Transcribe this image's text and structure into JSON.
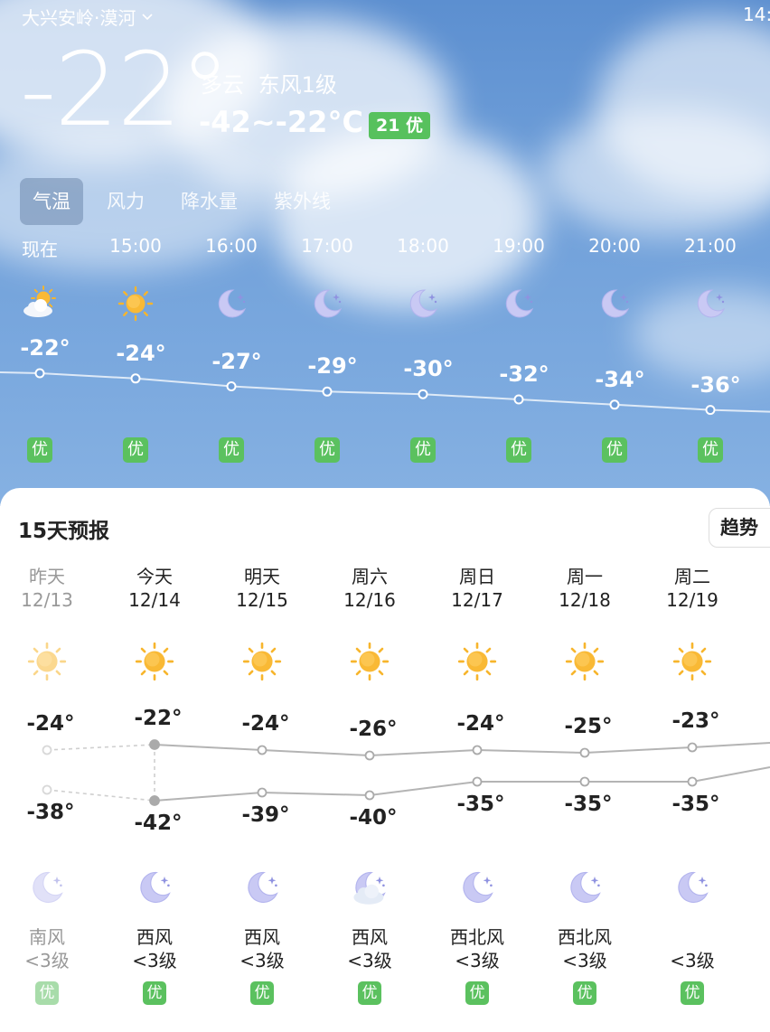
{
  "header": {
    "location": "大兴安岭·漠河",
    "clock": "14:",
    "current_temp": "-22°",
    "condition": "多云  东风1级",
    "temp_range": "-42~-22°C",
    "aqi_badge": "21 优"
  },
  "tabs": [
    "气温",
    "风力",
    "降水量",
    "紫外线"
  ],
  "active_tab": "气温",
  "hourly": [
    {
      "time": "现在",
      "icon": "partly-cloudy-icon",
      "temp": -22,
      "temp_label": "-22°",
      "aqi": "优"
    },
    {
      "time": "15:00",
      "icon": "sun-icon",
      "temp": -24,
      "temp_label": "-24°",
      "aqi": "优"
    },
    {
      "time": "16:00",
      "icon": "moon-icon",
      "temp": -27,
      "temp_label": "-27°",
      "aqi": "优"
    },
    {
      "time": "17:00",
      "icon": "moon-icon",
      "temp": -29,
      "temp_label": "-29°",
      "aqi": "优"
    },
    {
      "time": "18:00",
      "icon": "moon-icon",
      "temp": -30,
      "temp_label": "-30°",
      "aqi": "优"
    },
    {
      "time": "19:00",
      "icon": "moon-icon",
      "temp": -32,
      "temp_label": "-32°",
      "aqi": "优"
    },
    {
      "time": "20:00",
      "icon": "moon-icon",
      "temp": -34,
      "temp_label": "-34°",
      "aqi": "优"
    },
    {
      "time": "21:00",
      "icon": "moon-icon",
      "temp": -36,
      "temp_label": "-36°",
      "aqi": "优"
    }
  ],
  "forecast": {
    "title": "15天预报",
    "trend_button": "趋势",
    "days": [
      {
        "name": "昨天",
        "date": "12/13",
        "day_icon": "sun-icon",
        "high": -24,
        "high_label": "-24°",
        "low": -38,
        "low_label": "-38°",
        "night_icon": "moon-icon",
        "wind_dir": "南风",
        "wind_level": "<3级",
        "aqi": "优",
        "past": true
      },
      {
        "name": "今天",
        "date": "12/14",
        "day_icon": "sun-icon",
        "high": -22,
        "high_label": "-22°",
        "low": -42,
        "low_label": "-42°",
        "night_icon": "moon-icon",
        "wind_dir": "西风",
        "wind_level": "<3级",
        "aqi": "优",
        "past": false
      },
      {
        "name": "明天",
        "date": "12/15",
        "day_icon": "sun-icon",
        "high": -24,
        "high_label": "-24°",
        "low": -39,
        "low_label": "-39°",
        "night_icon": "moon-icon",
        "wind_dir": "西风",
        "wind_level": "<3级",
        "aqi": "优",
        "past": false
      },
      {
        "name": "周六",
        "date": "12/16",
        "day_icon": "sun-icon",
        "high": -26,
        "high_label": "-26°",
        "low": -40,
        "low_label": "-40°",
        "night_icon": "cloudy-moon-icon",
        "wind_dir": "西风",
        "wind_level": "<3级",
        "aqi": "优",
        "past": false
      },
      {
        "name": "周日",
        "date": "12/17",
        "day_icon": "sun-icon",
        "high": -24,
        "high_label": "-24°",
        "low": -35,
        "low_label": "-35°",
        "night_icon": "moon-icon",
        "wind_dir": "西北风",
        "wind_level": "<3级",
        "aqi": "优",
        "past": false
      },
      {
        "name": "周一",
        "date": "12/18",
        "day_icon": "sun-icon",
        "high": -25,
        "high_label": "-25°",
        "low": -35,
        "low_label": "-35°",
        "night_icon": "moon-icon",
        "wind_dir": "西北风",
        "wind_level": "<3级",
        "aqi": "优",
        "past": false
      },
      {
        "name": "周二",
        "date": "12/19",
        "day_icon": "sun-icon",
        "high": -23,
        "high_label": "-23°",
        "low": -35,
        "low_label": "-35°",
        "night_icon": "moon-icon",
        "wind_dir": "",
        "wind_level": "<3级",
        "aqi": "优",
        "past": false
      }
    ]
  },
  "colors": {
    "sky_top": "#5c8fd0",
    "aqi_good": "#5bc15f",
    "line_gray": "#b4b4b4",
    "sun": "#f7b52c",
    "moon": "#bcbef2"
  }
}
